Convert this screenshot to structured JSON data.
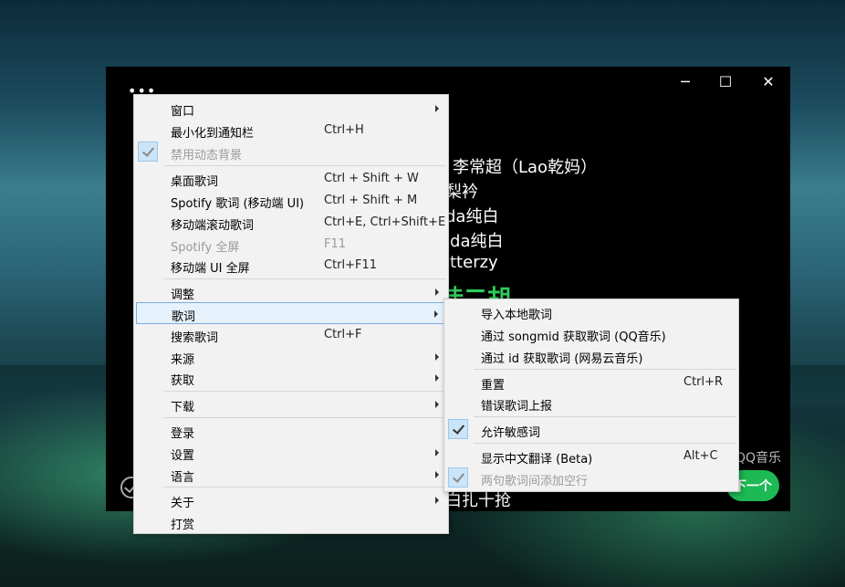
{
  "window": {
    "minimize": "─",
    "maximize": "☐",
    "close": "✕"
  },
  "lyrics": [
    "李常超（Lao乾妈）",
    "梨衿",
    "da纯白",
    "oda纯白",
    "itterzy",
    "徒二胡",
    "白扎十抢"
  ],
  "source_label": "QQ音乐",
  "next_button": "下一个",
  "main_menu": {
    "items": [
      {
        "label": "窗口",
        "submenu": true
      },
      {
        "label": "最小化到通知栏",
        "shortcut": "Ctrl+H"
      },
      {
        "label": "禁用动态背景",
        "checked": true,
        "disabled": true
      },
      {
        "label": "桌面歌词",
        "shortcut": "Ctrl + Shift + W"
      },
      {
        "label": "Spotify 歌词 (移动端 UI)",
        "shortcut": "Ctrl + Shift + M"
      },
      {
        "label": "移动端滚动歌词",
        "shortcut": "Ctrl+E, Ctrl+Shift+E"
      },
      {
        "label": "Spotify 全屏",
        "shortcut": "F11",
        "disabled": true
      },
      {
        "label": "移动端 UI 全屏",
        "shortcut": "Ctrl+F11"
      },
      {
        "label": "调整",
        "submenu": true
      },
      {
        "label": "歌词",
        "submenu": true,
        "highlighted": true
      },
      {
        "label": "搜索歌词",
        "shortcut": "Ctrl+F"
      },
      {
        "label": "来源",
        "submenu": true
      },
      {
        "label": "获取",
        "submenu": true
      },
      {
        "label": "下载",
        "submenu": true
      },
      {
        "label": "登录"
      },
      {
        "label": "设置",
        "submenu": true
      },
      {
        "label": "语言",
        "submenu": true
      },
      {
        "label": "关于",
        "submenu": true
      },
      {
        "label": "打赏"
      }
    ]
  },
  "lyrics_submenu": {
    "items": [
      {
        "label": "导入本地歌词"
      },
      {
        "label": "通过 songmid 获取歌词 (QQ音乐)"
      },
      {
        "label": "通过 id 获取歌词 (网易云音乐)"
      },
      {
        "label": "重置",
        "shortcut": "Ctrl+R"
      },
      {
        "label": "错误歌词上报"
      },
      {
        "label": "允许敏感词",
        "checked": true
      },
      {
        "label": "显示中文翻译 (Beta)",
        "shortcut": "Alt+C"
      },
      {
        "label": "两句歌词间添加空行",
        "checked": true,
        "disabled": true
      }
    ]
  }
}
